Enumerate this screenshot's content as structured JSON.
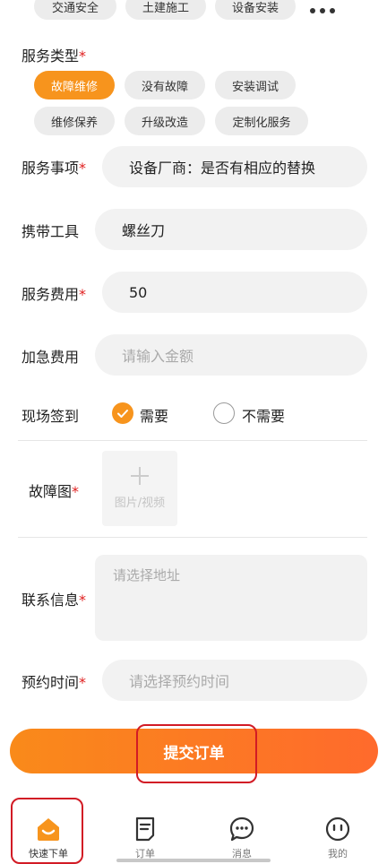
{
  "top_chips": [
    "交通安全",
    "土建施工",
    "设备安装"
  ],
  "more_icon": "more-dots-icon",
  "service_type": {
    "label": "服务类型",
    "required": "*",
    "options": [
      "故障维修",
      "没有故障",
      "安装调试",
      "维修保养",
      "升级改造",
      "定制化服务"
    ],
    "selected": "故障维修"
  },
  "service_item": {
    "label": "服务事项",
    "required": "*",
    "value": "设备厂商：是否有相应的替换"
  },
  "tools": {
    "label": "携带工具",
    "value": "螺丝刀"
  },
  "service_fee": {
    "label": "服务费用",
    "required": "*",
    "value": "50"
  },
  "urgent_fee": {
    "label": "加急费用",
    "placeholder": "请输入金额"
  },
  "checkin": {
    "label": "现场签到",
    "option_yes": "需要",
    "option_no": "不需要",
    "selected": "需要"
  },
  "fault_image": {
    "label": "故障图",
    "required": "*",
    "upload_text": "图片/视频"
  },
  "contact": {
    "label": "联系信息",
    "required": "*",
    "placeholder": "请选择地址"
  },
  "appointment": {
    "label": "预约时间",
    "required": "*",
    "placeholder": "请选择预约时间"
  },
  "submit_label": "提交订单",
  "tabs": [
    {
      "label": "快速下单",
      "icon": "home-smile-icon",
      "active": true
    },
    {
      "label": "订单",
      "icon": "order-document-icon",
      "active": false
    },
    {
      "label": "消息",
      "icon": "message-bubble-icon",
      "active": false
    },
    {
      "label": "我的",
      "icon": "profile-face-icon",
      "active": false
    }
  ],
  "colors": {
    "accent": "#f7941d",
    "required": "#e02020",
    "highlight_box": "#d21b25"
  }
}
